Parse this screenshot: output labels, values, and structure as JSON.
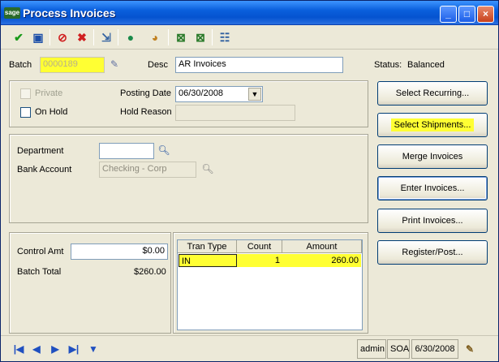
{
  "window": {
    "brand_badge": "sage",
    "title": "Process Invoices",
    "controls": {
      "minimize": "_",
      "maximize": "□",
      "close": "×"
    }
  },
  "toolbar": {
    "icons": [
      "check-icon",
      "save-icon",
      "cancel-icon",
      "delete-icon",
      "export-icon",
      "help-icon",
      "chart-icon",
      "batch-icon",
      "approve-icon",
      "list-icon"
    ]
  },
  "header": {
    "batch_label": "Batch",
    "batch_value": "0000189",
    "desc_label": "Desc",
    "desc_value": "AR Invoices",
    "status_label": "Status:",
    "status_value": "Balanced"
  },
  "options": {
    "private_label": "Private",
    "on_hold_label": "On Hold",
    "posting_date_label": "Posting Date",
    "posting_date_value": "06/30/2008",
    "hold_reason_label": "Hold Reason",
    "hold_reason_value": ""
  },
  "accounts": {
    "department_label": "Department",
    "department_value": "",
    "bank_account_label": "Bank Account",
    "bank_account_value": "Checking - Corp"
  },
  "totals": {
    "control_amt_label": "Control Amt",
    "control_amt_value": "$0.00",
    "batch_total_label": "Batch Total",
    "batch_total_value": "$260.00"
  },
  "grid": {
    "columns": [
      "Tran Type",
      "Count",
      "Amount"
    ],
    "rows": [
      {
        "tran_type": "IN",
        "count": "1",
        "amount": "260.00"
      }
    ]
  },
  "buttons": {
    "select_recurring": "Select Recurring...",
    "select_shipments": "Select Shipments...",
    "merge_invoices": "Merge Invoices",
    "enter_invoices": "Enter Invoices...",
    "print_invoices": "Print Invoices...",
    "register_post": "Register/Post..."
  },
  "statusbar": {
    "user": "admin",
    "company": "SOA",
    "date": "6/30/2008"
  },
  "colors": {
    "highlight": "#ffff33",
    "title_bar": "#0553d0"
  }
}
